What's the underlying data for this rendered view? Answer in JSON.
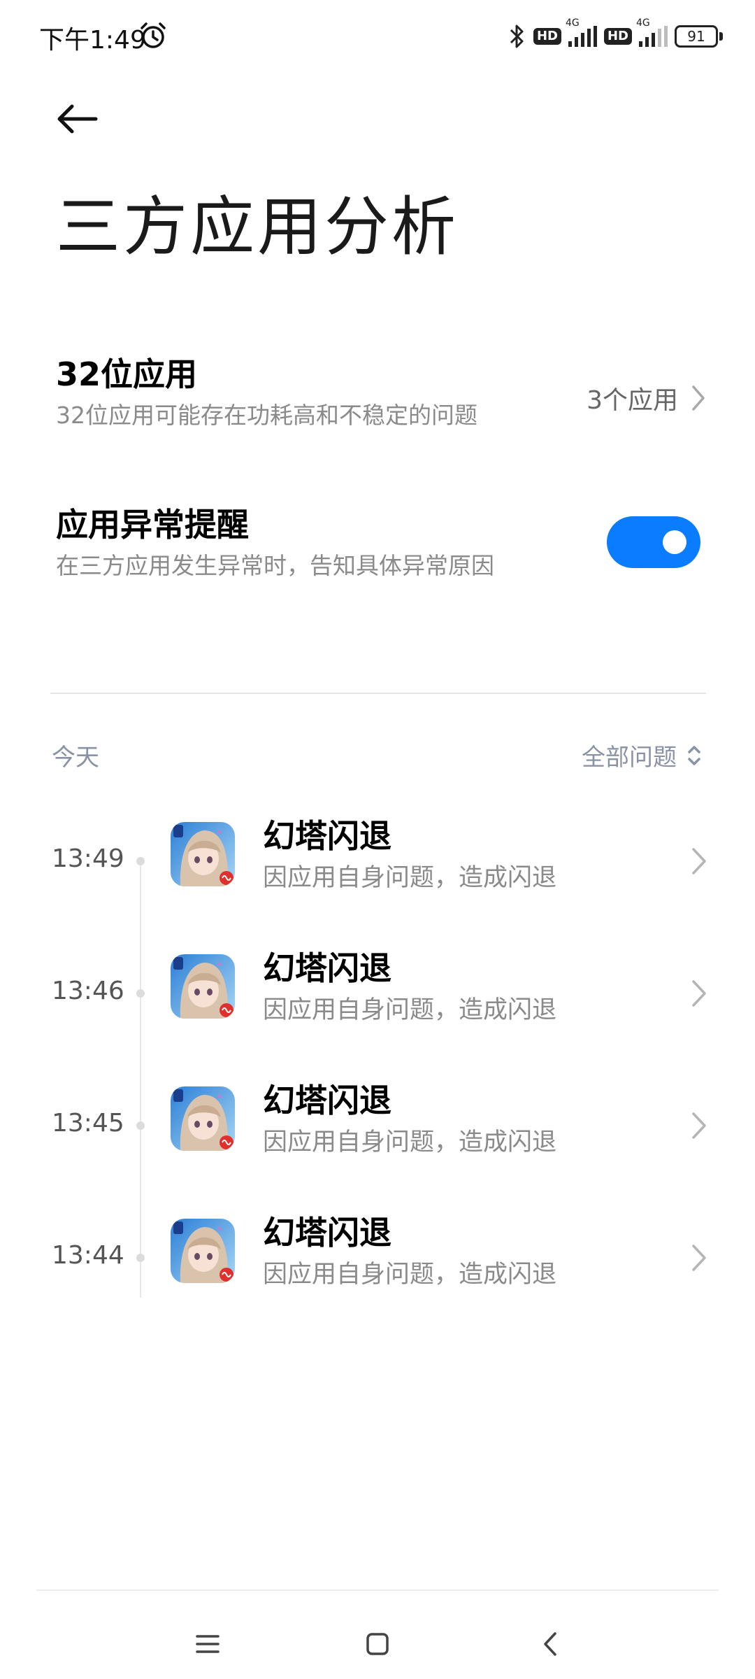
{
  "status_bar": {
    "time": "下午1:49",
    "network_tag_1": "4G",
    "network_tag_2": "4G",
    "hd_label": "HD",
    "battery": "91"
  },
  "page": {
    "title": "三方应用分析"
  },
  "settings": {
    "app32": {
      "title": "32位应用",
      "subtitle": "32位应用可能存在功耗高和不稳定的问题",
      "value": "3个应用"
    },
    "alert": {
      "title": "应用异常提醒",
      "subtitle": "在三方应用发生异常时，告知具体异常原因",
      "enabled": true
    }
  },
  "filter": {
    "today_label": "今天",
    "filter_label": "全部问题"
  },
  "events": [
    {
      "time": "13:49",
      "title": "幻塔闪退",
      "subtitle": "因应用自身问题，造成闪退"
    },
    {
      "time": "13:46",
      "title": "幻塔闪退",
      "subtitle": "因应用自身问题，造成闪退"
    },
    {
      "time": "13:45",
      "title": "幻塔闪退",
      "subtitle": "因应用自身问题，造成闪退"
    },
    {
      "time": "13:44",
      "title": "幻塔闪退",
      "subtitle": "因应用自身问题，造成闪退"
    }
  ],
  "colors": {
    "accent": "#0a7cff",
    "secondary_text": "#8a8a8a",
    "filter_text": "#8a93a6"
  },
  "icons": {
    "back": "arrow-left-icon",
    "alarm": "alarm-clock-icon",
    "bluetooth": "bluetooth-icon",
    "chevron": "chevron-right-icon",
    "sort": "sort-updown-icon",
    "nav_menu": "menu-icon",
    "nav_home": "home-square-icon",
    "nav_back": "back-chevron-icon"
  }
}
